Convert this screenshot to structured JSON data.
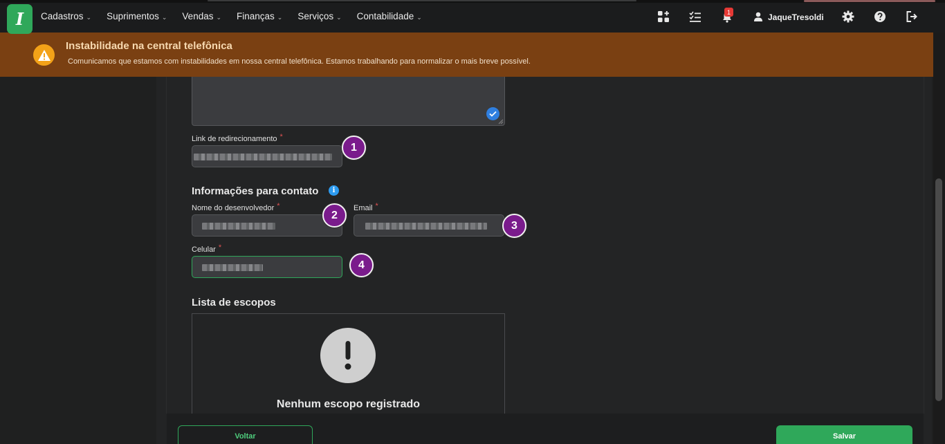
{
  "nav": {
    "logo": "I",
    "menu": [
      {
        "label": "Cadastros"
      },
      {
        "label": "Suprimentos"
      },
      {
        "label": "Vendas"
      },
      {
        "label": "Finanças"
      },
      {
        "label": "Serviços"
      },
      {
        "label": "Contabilidade"
      }
    ],
    "notifications_count": "1",
    "username": "JaqueTresoldi"
  },
  "alert": {
    "title": "Instabilidade na central telefônica",
    "message": "Comunicamos que estamos com instabilidades em nossa central telefônica. Estamos trabalhando para normalizar o mais breve possível."
  },
  "form": {
    "redirect_link": {
      "label": "Link de redirecionamento",
      "required_mark": "*",
      "marker": "1"
    },
    "contact_section_title": "Informações para contato",
    "info_glyph": "i",
    "developer_name": {
      "label": "Nome do desenvolvedor",
      "required_mark": "*",
      "marker": "2"
    },
    "email": {
      "label": "Email",
      "required_mark": "*",
      "marker": "3"
    },
    "phone": {
      "label": "Celular",
      "required_mark": "*",
      "marker": "4"
    },
    "scopes_title": "Lista de escopos",
    "scopes_empty": "Nenhum escopo registrado"
  },
  "footer": {
    "back_label": "Voltar",
    "save_label": "Salvar"
  },
  "colors": {
    "brand_green": "#2fa85a",
    "alert_bg": "#7a4012",
    "marker_purple": "#7a1b8c"
  }
}
